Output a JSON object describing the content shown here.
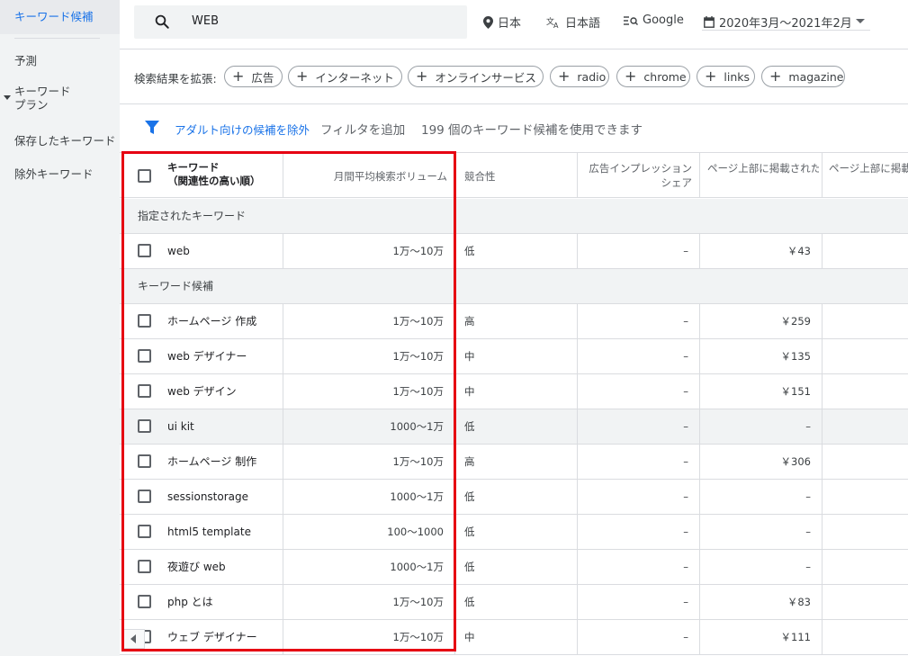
{
  "sidebar": {
    "items": [
      {
        "label": "キーワード候補",
        "active": true
      },
      {
        "label": "予測"
      },
      {
        "label": "キーワード\nプラン"
      },
      {
        "label": "保存したキーワード"
      },
      {
        "label": "除外キーワード"
      }
    ]
  },
  "search": {
    "query": "WEB"
  },
  "meta": {
    "location": "日本",
    "language": "日本語",
    "network": "Google",
    "date_range": "2020年3月～2021年2月"
  },
  "expand": {
    "label": "検索結果を拡張:",
    "chips": [
      "広告",
      "インターネット",
      "オンラインサービス",
      "radio",
      "chrome",
      "links",
      "magazine"
    ]
  },
  "filter": {
    "exclude_adult": "アダルト向けの候補を除外",
    "add_filter": "フィルタを追加",
    "count_text": "199 個のキーワード候補を使用できます"
  },
  "table": {
    "headers": {
      "keyword_line1": "キーワード",
      "keyword_line2": "（関連性の高い順）",
      "volume": "月間平均検索ボリューム",
      "competition": "競合性",
      "impression_line1": "広告インプレッション",
      "impression_line2": "シェア",
      "top_bid_low": "ページ上部に掲載された",
      "top_bid_high": "ページ上部に掲載"
    },
    "groups": {
      "specified": "指定されたキーワード",
      "ideas": "キーワード候補"
    },
    "specified_rows": [
      {
        "keyword": "web",
        "volume": "1万～10万",
        "competition": "低",
        "impression": "–",
        "bid_low": "￥43"
      }
    ],
    "idea_rows": [
      {
        "keyword": "ホームページ 作成",
        "volume": "1万～10万",
        "competition": "高",
        "impression": "–",
        "bid_low": "￥259"
      },
      {
        "keyword": "web デザイナー",
        "volume": "1万～10万",
        "competition": "中",
        "impression": "–",
        "bid_low": "￥135"
      },
      {
        "keyword": "web デザイン",
        "volume": "1万～10万",
        "competition": "中",
        "impression": "–",
        "bid_low": "￥151"
      },
      {
        "keyword": "ui kit",
        "volume": "1000～1万",
        "competition": "低",
        "impression": "–",
        "bid_low": "–"
      },
      {
        "keyword": "ホームページ 制作",
        "volume": "1万～10万",
        "competition": "高",
        "impression": "–",
        "bid_low": "￥306"
      },
      {
        "keyword": "sessionstorage",
        "volume": "1000～1万",
        "competition": "低",
        "impression": "–",
        "bid_low": "–"
      },
      {
        "keyword": "html5 template",
        "volume": "100～1000",
        "competition": "低",
        "impression": "–",
        "bid_low": "–"
      },
      {
        "keyword": "夜遊び web",
        "volume": "1000～1万",
        "competition": "低",
        "impression": "–",
        "bid_low": "–"
      },
      {
        "keyword": "php とは",
        "volume": "1万～10万",
        "competition": "低",
        "impression": "–",
        "bid_low": "￥83"
      },
      {
        "keyword": "ウェブ デザイナー",
        "volume": "1万～10万",
        "competition": "中",
        "impression": "–",
        "bid_low": "￥111"
      }
    ]
  },
  "colors": {
    "accent": "#1a73e8",
    "highlight_box": "#e60012"
  }
}
